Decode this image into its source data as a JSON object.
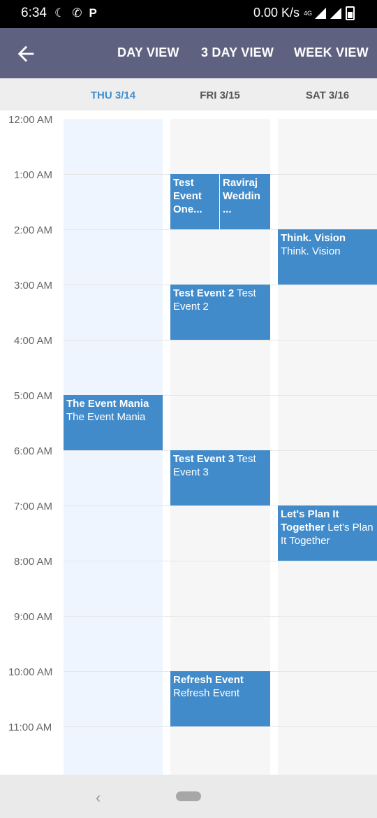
{
  "statusbar": {
    "time": "6:34",
    "left_icons": [
      "moon-icon",
      "phone-icon",
      "parking-icon"
    ],
    "speed": "0.00 K/s",
    "network": "4G"
  },
  "appbar": {
    "day_view": "DAY VIEW",
    "three_day_view": "3 DAY VIEW",
    "week_view": "WEEK VIEW"
  },
  "dates": [
    "THU 3/14",
    "FRI 3/15",
    "SAT 3/16"
  ],
  "times": [
    "12:00 AM",
    "1:00 AM",
    "2:00 AM",
    "3:00 AM",
    "4:00 AM",
    "5:00 AM",
    "6:00 AM",
    "7:00 AM",
    "8:00 AM",
    "9:00 AM",
    "10:00 AM",
    "11:00 AM"
  ],
  "events": {
    "ev_test1": {
      "title": "Test Event One...",
      "sub": ""
    },
    "ev_raviraj": {
      "title": "Raviraj Weddin ...",
      "sub": ""
    },
    "ev_think": {
      "title": "Think. Vision",
      "sub": "Think. Vision"
    },
    "ev_test2": {
      "title": "Test Event 2",
      "sub": " Test Event 2"
    },
    "ev_mania": {
      "title": "The Event Mania",
      "sub": "The Event Mania"
    },
    "ev_test3": {
      "title": "Test Event 3",
      "sub": " Test Event 3"
    },
    "ev_plan": {
      "title": "Let's Plan It Together",
      "sub": " Let's Plan It Together"
    },
    "ev_refresh": {
      "title": "Refresh Event",
      "sub": "Refresh Event"
    }
  },
  "colors": {
    "appbar": "#5e6280",
    "event": "#428bca",
    "today": "#3e8ed1"
  }
}
